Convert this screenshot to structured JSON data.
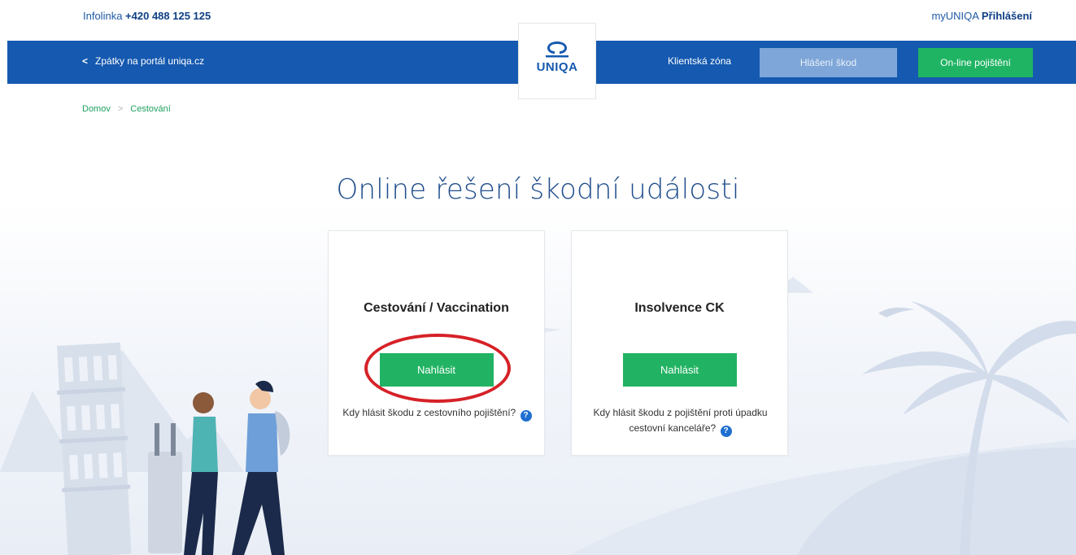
{
  "topbar": {
    "infoline_label": "Infolinka",
    "infoline_phone": "+420 488 125 125",
    "myuniqa_label": "myUNIQA",
    "login_label": "Přihlášení"
  },
  "nav": {
    "back_label": "Zpátky na portál uniqa.cz",
    "client_zone": "Klientská zóna",
    "claims": "Hlášení škod",
    "online_insurance": "On-line pojištění"
  },
  "logo": {
    "text": "UNIQA"
  },
  "breadcrumb": {
    "home": "Domov",
    "current": "Cestování"
  },
  "page_title": "Online řešení škodní události",
  "cards": [
    {
      "title": "Cestování / Vaccination",
      "button": "Nahlásit",
      "help": "Kdy hlásit škodu z cestovního pojištění?"
    },
    {
      "title": "Insolvence CK",
      "button": "Nahlásit",
      "help": "Kdy hlásit škodu z pojištění proti úpadku cestovní kanceláře?"
    }
  ],
  "help_icon_glyph": "?",
  "colors": {
    "brand_blue": "#1559b0",
    "accent_green": "#21b363",
    "highlight_red": "#d62127",
    "claims_button": "#7ea6d8"
  }
}
